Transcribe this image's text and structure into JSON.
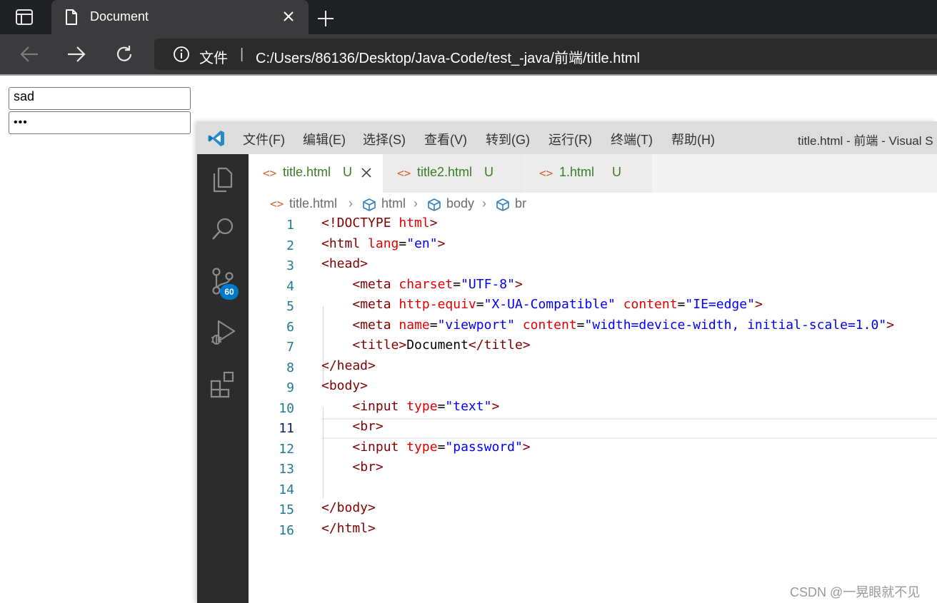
{
  "browser": {
    "tab_title": "Document",
    "address_label": "文件",
    "address_separator": "|",
    "url": "C:/Users/86136/Desktop/Java-Code/test_-java/前端/title.html"
  },
  "page": {
    "text_input_value": "sad",
    "password_input_value": "•••"
  },
  "vscode": {
    "menu": [
      "文件(F)",
      "编辑(E)",
      "选择(S)",
      "查看(V)",
      "转到(G)",
      "运行(R)",
      "终端(T)",
      "帮助(H)"
    ],
    "window_title": "title.html - 前端 - Visual S",
    "badge_count": "60",
    "tabs": [
      {
        "name": "title.html",
        "status": "U",
        "active": true
      },
      {
        "name": "title2.html",
        "status": "U",
        "active": false
      },
      {
        "name": "1.html",
        "status": "U",
        "active": false
      }
    ],
    "breadcrumb": [
      "title.html",
      "html",
      "body",
      "br"
    ],
    "line_numbers": [
      "1",
      "2",
      "3",
      "4",
      "5",
      "6",
      "7",
      "8",
      "9",
      "10",
      "11",
      "12",
      "13",
      "14",
      "15",
      "16"
    ],
    "current_line": "11",
    "code_lines": [
      [
        {
          "c": "t",
          "s": "<!DOCTYPE "
        },
        {
          "c": "a",
          "s": "html"
        },
        {
          "c": "t",
          "s": ">"
        }
      ],
      [
        {
          "c": "t",
          "s": "<html "
        },
        {
          "c": "a",
          "s": "lang"
        },
        {
          "c": "x",
          "s": "="
        },
        {
          "c": "v",
          "s": "\"en\""
        },
        {
          "c": "t",
          "s": ">"
        }
      ],
      [
        {
          "c": "t",
          "s": "<head>"
        }
      ],
      [
        {
          "c": "x",
          "s": "    "
        },
        {
          "c": "t",
          "s": "<meta "
        },
        {
          "c": "a",
          "s": "charset"
        },
        {
          "c": "x",
          "s": "="
        },
        {
          "c": "v",
          "s": "\"UTF-8\""
        },
        {
          "c": "t",
          "s": ">"
        }
      ],
      [
        {
          "c": "x",
          "s": "    "
        },
        {
          "c": "t",
          "s": "<meta "
        },
        {
          "c": "a",
          "s": "http-equiv"
        },
        {
          "c": "x",
          "s": "="
        },
        {
          "c": "v",
          "s": "\"X-UA-Compatible\""
        },
        {
          "c": "x",
          "s": " "
        },
        {
          "c": "a",
          "s": "content"
        },
        {
          "c": "x",
          "s": "="
        },
        {
          "c": "v",
          "s": "\"IE=edge\""
        },
        {
          "c": "t",
          "s": ">"
        }
      ],
      [
        {
          "c": "x",
          "s": "    "
        },
        {
          "c": "t",
          "s": "<meta "
        },
        {
          "c": "a",
          "s": "name"
        },
        {
          "c": "x",
          "s": "="
        },
        {
          "c": "v",
          "s": "\"viewport\""
        },
        {
          "c": "x",
          "s": " "
        },
        {
          "c": "a",
          "s": "content"
        },
        {
          "c": "x",
          "s": "="
        },
        {
          "c": "v",
          "s": "\"width=device-width, initial-scale=1.0\""
        },
        {
          "c": "t",
          "s": ">"
        }
      ],
      [
        {
          "c": "x",
          "s": "    "
        },
        {
          "c": "t",
          "s": "<title>"
        },
        {
          "c": "x",
          "s": "Document"
        },
        {
          "c": "t",
          "s": "</title>"
        }
      ],
      [
        {
          "c": "t",
          "s": "</head>"
        }
      ],
      [
        {
          "c": "t",
          "s": "<body>"
        }
      ],
      [
        {
          "c": "x",
          "s": "    "
        },
        {
          "c": "t",
          "s": "<input "
        },
        {
          "c": "a",
          "s": "type"
        },
        {
          "c": "x",
          "s": "="
        },
        {
          "c": "v",
          "s": "\"text\""
        },
        {
          "c": "t",
          "s": ">"
        }
      ],
      [
        {
          "c": "x",
          "s": "    "
        },
        {
          "c": "t",
          "s": "<br>"
        }
      ],
      [
        {
          "c": "x",
          "s": "    "
        },
        {
          "c": "t",
          "s": "<input "
        },
        {
          "c": "a",
          "s": "type"
        },
        {
          "c": "x",
          "s": "="
        },
        {
          "c": "v",
          "s": "\"password\""
        },
        {
          "c": "t",
          "s": ">"
        }
      ],
      [
        {
          "c": "x",
          "s": "    "
        },
        {
          "c": "t",
          "s": "<br>"
        }
      ],
      [
        {
          "c": "x",
          "s": ""
        }
      ],
      [
        {
          "c": "t",
          "s": "</body>"
        }
      ],
      [
        {
          "c": "t",
          "s": "</html>"
        }
      ]
    ]
  },
  "watermark": "CSDN @一晃眼就不见",
  "colors": {
    "tag": "#800000",
    "attribute": "#e50000",
    "string": "#0000ff",
    "line_number": "#237893",
    "git_untracked": "#3a7d24",
    "html_file_icon": "#d1602d",
    "badge": "#007acc"
  }
}
